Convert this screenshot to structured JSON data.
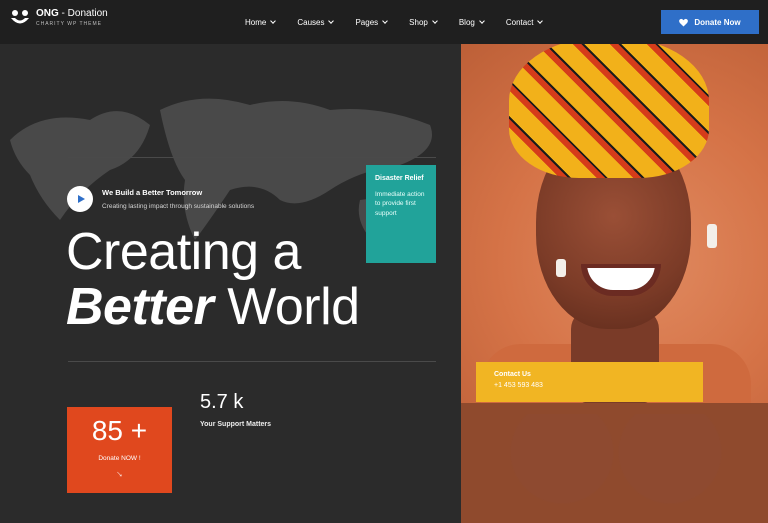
{
  "header": {
    "logo_title": "ONG",
    "logo_title_suffix": " - Donation",
    "logo_tagline": "CHARITY WP THEME",
    "nav_items": [
      "Home",
      "Causes",
      "Pages",
      "Shop",
      "Blog",
      "Contact"
    ],
    "donate_label": "Donate Now"
  },
  "hero": {
    "tagline_title": "We Build a Better Tomorrow",
    "tagline_sub": "Creating lasting impact through sustainable solutions",
    "headline_line1": "Creating a",
    "headline_bold": "Better",
    "headline_rest": " World"
  },
  "relief": {
    "title": "Disaster Relief",
    "text": "Immediate action to provide first support"
  },
  "contact": {
    "title": "Contact Us",
    "phone": "+1 453 593 483"
  },
  "stats": {
    "donate_number": "85 +",
    "donate_label": "Donate NOW !",
    "donate_arrow": "→",
    "support_number": "5.7 k",
    "support_label": "Your Support Matters"
  },
  "colors": {
    "primary_blue": "#2f6fc8",
    "teal": "#21a39a",
    "orange_red": "#e0481e",
    "yellow": "#f1b523",
    "background": "#2b2b2b"
  },
  "icons": {
    "logo": "hands-heart-icon",
    "donate": "heart-icon",
    "play": "play-icon",
    "arrow": "arrow-down-right-icon"
  }
}
